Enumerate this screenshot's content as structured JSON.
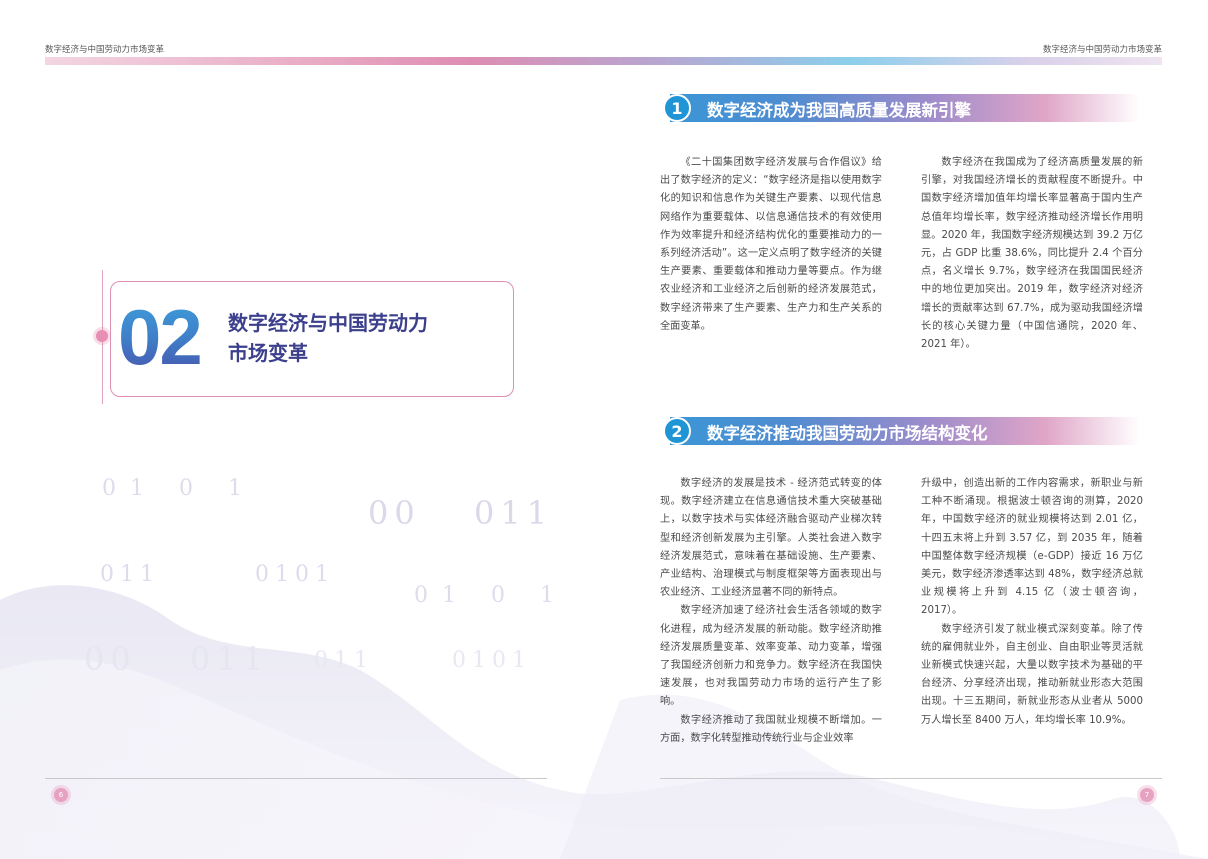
{
  "header": {
    "left_title": "数字经济与中国劳动力市场变革",
    "right_title": "数字经济与中国劳动力市场变革"
  },
  "chapter": {
    "number": "02",
    "title_line1": "数字经济与中国劳动力",
    "title_line2": "市场变革"
  },
  "decor_binary": [
    "01 0 1",
    "00",
    "011",
    "011",
    "0101",
    "01 0 1",
    "00",
    "011",
    "011",
    "0101"
  ],
  "section1": {
    "number": "1",
    "title": "数字经济成为我国高质量发展新引擎",
    "col_left": "《二十国集团数字经济发展与合作倡议》给出了数字经济的定义：“数字经济是指以使用数字化的知识和信息作为关键生产要素、以现代信息网络作为重要载体、以信息通信技术的有效使用作为效率提升和经济结构优化的重要推动力的一系列经济活动”。这一定义点明了数字经济的关键生产要素、重要载体和推动力量等要点。作为继农业经济和工业经济之后创新的经济发展范式，数字经济带来了生产要素、生产力和生产关系的全面变革。",
    "col_right": "数字经济在我国成为了经济高质量发展的新引擎，对我国经济增长的贡献程度不断提升。中国数字经济增加值年均增长率显著高于国内生产总值年均增长率，数字经济推动经济增长作用明显。2020 年，我国数字经济规模达到 39.2 万亿元，占 GDP 比重 38.6%，同比提升 2.4 个百分点，名义增长 9.7%，数字经济在我国国民经济中的地位更加突出。2019 年，数字经济对经济增长的贡献率达到 67.7%，成为驱动我国经济增长的核心关键力量（中国信通院，2020 年、2021 年）。"
  },
  "section2": {
    "number": "2",
    "title": "数字经济推动我国劳动力市场结构变化",
    "col_left_p1": "数字经济的发展是技术 - 经济范式转变的体现。数字经济建立在信息通信技术重大突破基础上，以数字技术与实体经济融合驱动产业梯次转型和经济创新发展为主引擎。人类社会进入数字经济发展范式，意味着在基础设施、生产要素、产业结构、治理模式与制度框架等方面表现出与农业经济、工业经济显著不同的新特点。",
    "col_left_p2": "数字经济加速了经济社会生活各领域的数字化进程，成为经济发展的新动能。数字经济助推经济发展质量变革、效率变革、动力变革，增强了我国经济创新力和竞争力。数字经济在我国快速发展，也对我国劳动力市场的运行产生了影响。",
    "col_left_p3": "数字经济推动了我国就业规模不断增加。一方面，数字化转型推动传统行业与企业效率",
    "col_right_p1": "升级中，创造出新的工作内容需求，新职业与新工种不断涌现。根据波士顿咨询的测算，2020 年，中国数字经济的就业规模将达到 2.01 亿，十四五末将上升到 3.57 亿，到 2035 年，随着中国整体数字经济规模（e-GDP）接近 16 万亿美元，数字经济渗透率达到 48%，数字经济总就业规模将上升到 4.15 亿（波士顿咨询，2017）。",
    "col_right_p2": "数字经济引发了就业模式深刻变革。除了传统的雇佣就业外，自主创业、自由职业等灵活就业新模式快速兴起，大量以数字技术为基础的平台经济、分享经济出现，推动新就业形态大范围出现。十三五期间，新就业形态从业者从 5000 万人增长至 8400 万人，年均增长率 10.9%。"
  },
  "footer": {
    "page_left": "6",
    "page_right": "7"
  },
  "colors": {
    "accent_blue": "#1f95d6",
    "accent_pink": "#e48fb3",
    "title_purple": "#3c3f8c"
  }
}
